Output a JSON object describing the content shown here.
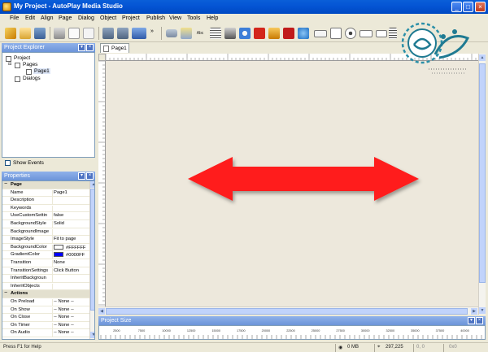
{
  "window": {
    "title": "My Project - AutoPlay Media Studio"
  },
  "menu": [
    "File",
    "Edit",
    "Align",
    "Page",
    "Dialog",
    "Object",
    "Project",
    "Publish",
    "View",
    "Tools",
    "Help"
  ],
  "toolbar": {
    "abc_label": "Abc"
  },
  "explorer": {
    "title": "Project Explorer",
    "tree": [
      {
        "label": "Project",
        "level": 0
      },
      {
        "label": "Pages",
        "level": 1
      },
      {
        "label": "Page1",
        "level": 2
      },
      {
        "label": "Dialogs",
        "level": 1
      }
    ],
    "show_events_label": "Show Events"
  },
  "properties": {
    "title": "Properties",
    "rows": [
      {
        "name": "Page",
        "value": "",
        "category": true
      },
      {
        "name": "Name",
        "value": "Page1"
      },
      {
        "name": "Description",
        "value": ""
      },
      {
        "name": "Keywords",
        "value": ""
      },
      {
        "name": "UseCustomSettin",
        "value": "false"
      },
      {
        "name": "BackgroundStyle",
        "value": "Solid"
      },
      {
        "name": "BackgroundImage",
        "value": ""
      },
      {
        "name": "ImageStyle",
        "value": "Fit to page"
      },
      {
        "name": "BackgroundColor",
        "value": "#FFFFFF",
        "swatch": "#FFFFFF"
      },
      {
        "name": "GradientColor",
        "value": "#0000FF",
        "swatch": "#0000FF"
      },
      {
        "name": "Transition",
        "value": "None"
      },
      {
        "name": "TransitionSettings",
        "value": "Click Button"
      },
      {
        "name": "InheritBackgroun",
        "value": ""
      },
      {
        "name": "InheritObjects",
        "value": ""
      },
      {
        "name": "Actions",
        "value": "",
        "category": true
      },
      {
        "name": "On Preload",
        "value": "-- None --"
      },
      {
        "name": "On Show",
        "value": "-- None --"
      },
      {
        "name": "On Close",
        "value": "-- None --"
      },
      {
        "name": "On Timer",
        "value": "-- None --"
      },
      {
        "name": "On Audio",
        "value": "-- None --"
      }
    ]
  },
  "document": {
    "tab": "Page1"
  },
  "project_size": {
    "title": "Project Size",
    "ticks": [
      "2500",
      "7500",
      "10000",
      "12500",
      "15000",
      "17500",
      "20000",
      "22500",
      "25000",
      "27500",
      "30000",
      "32500",
      "35000",
      "37500",
      "40000"
    ]
  },
  "status": {
    "help": "Press F1 for Help",
    "size": "0 MB",
    "coords": "297,225",
    "dims": "0, 0",
    "zoom": "0x0"
  },
  "colors": {
    "titlebar": "#0454d4",
    "panel_title": "#7aa1e6",
    "canvas": "#ede8dc",
    "arrow": "#ff1a1a"
  }
}
